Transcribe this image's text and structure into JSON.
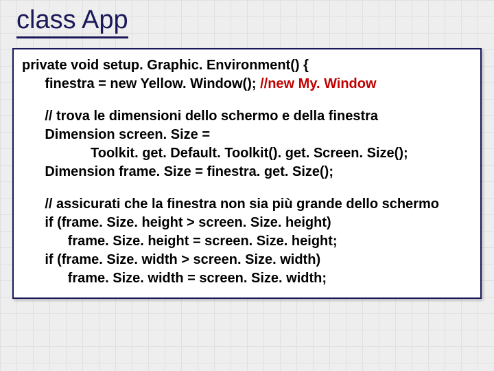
{
  "title": "class App",
  "code": {
    "l1a": "private void setup. Graphic. Environment() {",
    "l2a": "      finestra = new Yellow. Window(); ",
    "l2b": "//new My. Window",
    "l4": "      // trova le dimensioni dello schermo e della finestra",
    "l5": "      Dimension screen. Size = ",
    "l6": "                  Toolkit. get. Default. Toolkit(). get. Screen. Size();",
    "l7": "      Dimension frame. Size = finestra. get. Size();",
    "l9": "      // assicurati che la finestra non sia più grande dello schermo",
    "l10": "      if (frame. Size. height > screen. Size. height) ",
    "l11": "            frame. Size. height = screen. Size. height;",
    "l12": "      if (frame. Size. width > screen. Size. width) ",
    "l13": "            frame. Size. width = screen. Size. width;"
  }
}
